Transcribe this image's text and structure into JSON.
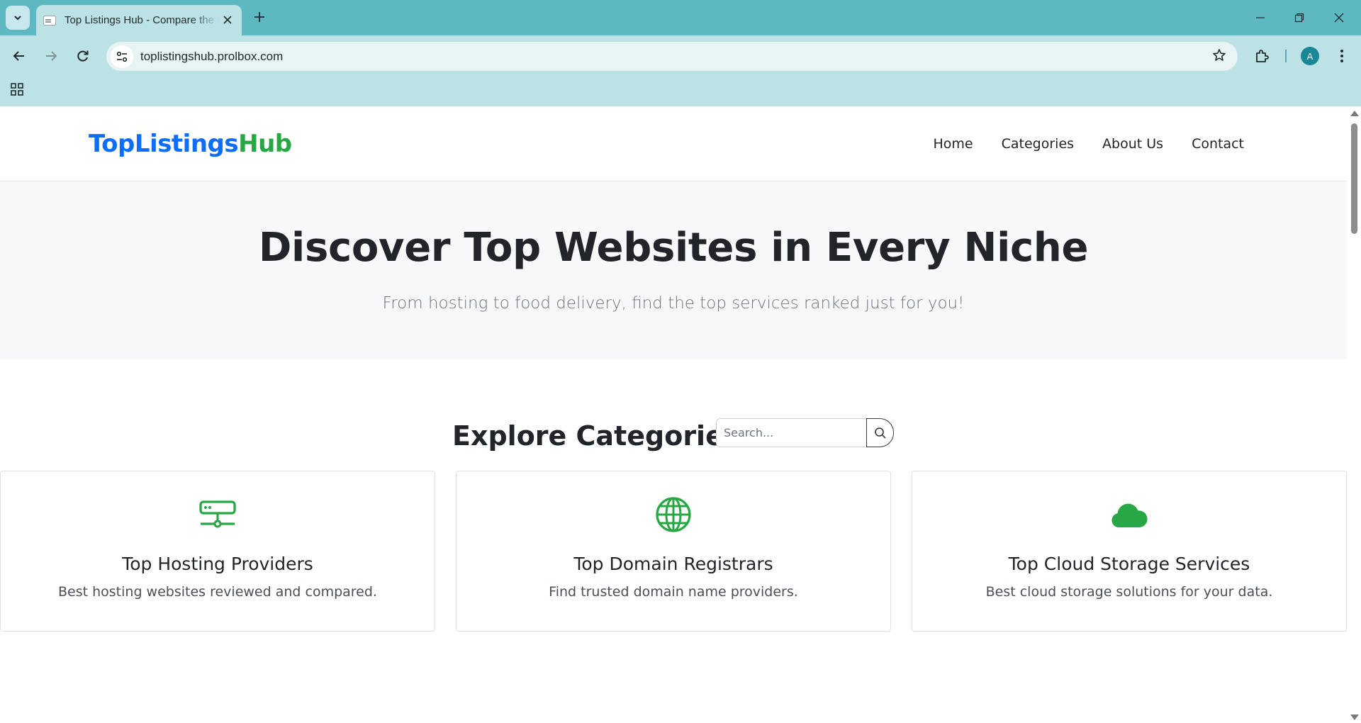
{
  "browser": {
    "tab_title": "Top Listings Hub - Compare the Best Websites",
    "url": "toplistingshub.prolbox.com",
    "profile_initial": "A",
    "icons": {
      "tab_search": "chevron-down-icon",
      "new_tab": "plus-icon",
      "back": "arrow-left-icon",
      "forward": "arrow-right-icon",
      "reload": "reload-icon",
      "site_info": "tune-icon",
      "bookmark": "star-icon",
      "extensions": "puzzle-icon",
      "menu": "kebab-icon",
      "apps": "grid-icon",
      "minimize": "minimize-icon",
      "restore": "restore-icon",
      "close": "close-icon"
    }
  },
  "site": {
    "logo_part1": "TopListings",
    "logo_part2": "Hub",
    "colors": {
      "logo_blue": "#0d6efd",
      "logo_green": "#28a745",
      "icon_green": "#28a745"
    },
    "nav": [
      {
        "label": "Home"
      },
      {
        "label": "Categories"
      },
      {
        "label": "About Us"
      },
      {
        "label": "Contact"
      }
    ]
  },
  "hero": {
    "title": "Discover Top Websites in Every Niche",
    "subtitle": "From hosting to food delivery, find the top services ranked just for you!"
  },
  "categories": {
    "title": "Explore Categories",
    "search_placeholder": "Search...",
    "search_icon": "search-icon",
    "items": [
      {
        "icon": "server-icon",
        "title": "Top Hosting Providers",
        "description": "Best hosting websites reviewed and compared."
      },
      {
        "icon": "globe-icon",
        "title": "Top Domain Registrars",
        "description": "Find trusted domain name providers."
      },
      {
        "icon": "cloud-icon",
        "title": "Top Cloud Storage Services",
        "description": "Best cloud storage solutions for your data."
      }
    ]
  }
}
